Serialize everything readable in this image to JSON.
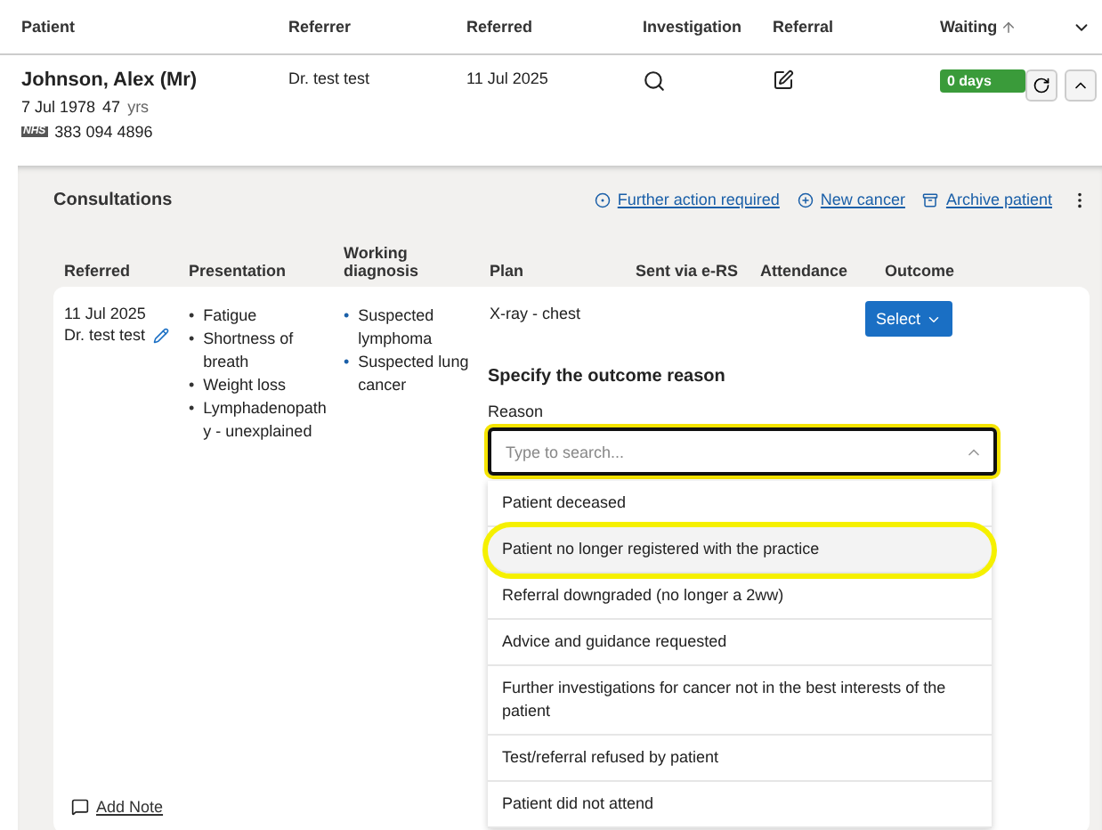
{
  "table": {
    "columns": [
      {
        "label": "Patient"
      },
      {
        "label": "Referrer"
      },
      {
        "label": "Referred"
      },
      {
        "label": "Investigation"
      },
      {
        "label": "Referral"
      },
      {
        "label": "Waiting",
        "sorted": true
      }
    ],
    "row": {
      "name": "Johnson, Alex (Mr)",
      "dob": "7 Jul 1978",
      "age": "47",
      "age_unit": "yrs",
      "nhs_logo": "NHS",
      "nhs_number": "383 094 4896",
      "referrer": "Dr. test test",
      "referred": "11 Jul 2025",
      "waiting": "0 days",
      "expanded": true
    }
  },
  "consultations": {
    "title": "Consultations",
    "actions": [
      {
        "label": "Further action required",
        "kind": "flag"
      },
      {
        "label": "New cancer",
        "kind": "add"
      },
      {
        "label": "Archive patient",
        "kind": "archive"
      }
    ],
    "columns": [
      "Referred",
      "Presentation",
      "Working diagnosis",
      "Plan",
      "Sent via e-RS",
      "Attendance",
      "Outcome"
    ],
    "entry": {
      "bullet": "•",
      "date": "11 Jul 2025",
      "referrer": "Dr. test test",
      "presentation": [
        "Fatigue",
        "Shortness of breath",
        "Weight loss",
        "Lymphadenopath y - unexplained"
      ],
      "diagnosis": [
        "Suspected lymphoma",
        "Suspected lung cancer"
      ],
      "plan": "X-ray - chest",
      "outcome_button": "Select"
    },
    "add_note": "Add Note",
    "outcome_popover": {
      "title": "Specify the outcome reason",
      "label": "Reason",
      "placeholder": "Type to search...",
      "options": [
        {
          "label": "Patient deceased",
          "highlighted": false
        },
        {
          "label": "Patient no longer registered with the practice",
          "highlighted": true
        },
        {
          "label": "Referral downgraded (no longer a 2ww)",
          "highlighted": false
        },
        {
          "label": "Advice and guidance requested",
          "highlighted": false
        },
        {
          "label": "Further investigations for cancer not in the best interests of the patient",
          "highlighted": false
        },
        {
          "label": "Test/referral refused by patient",
          "highlighted": false
        },
        {
          "label": "Patient did not attend",
          "highlighted": false
        }
      ]
    }
  }
}
